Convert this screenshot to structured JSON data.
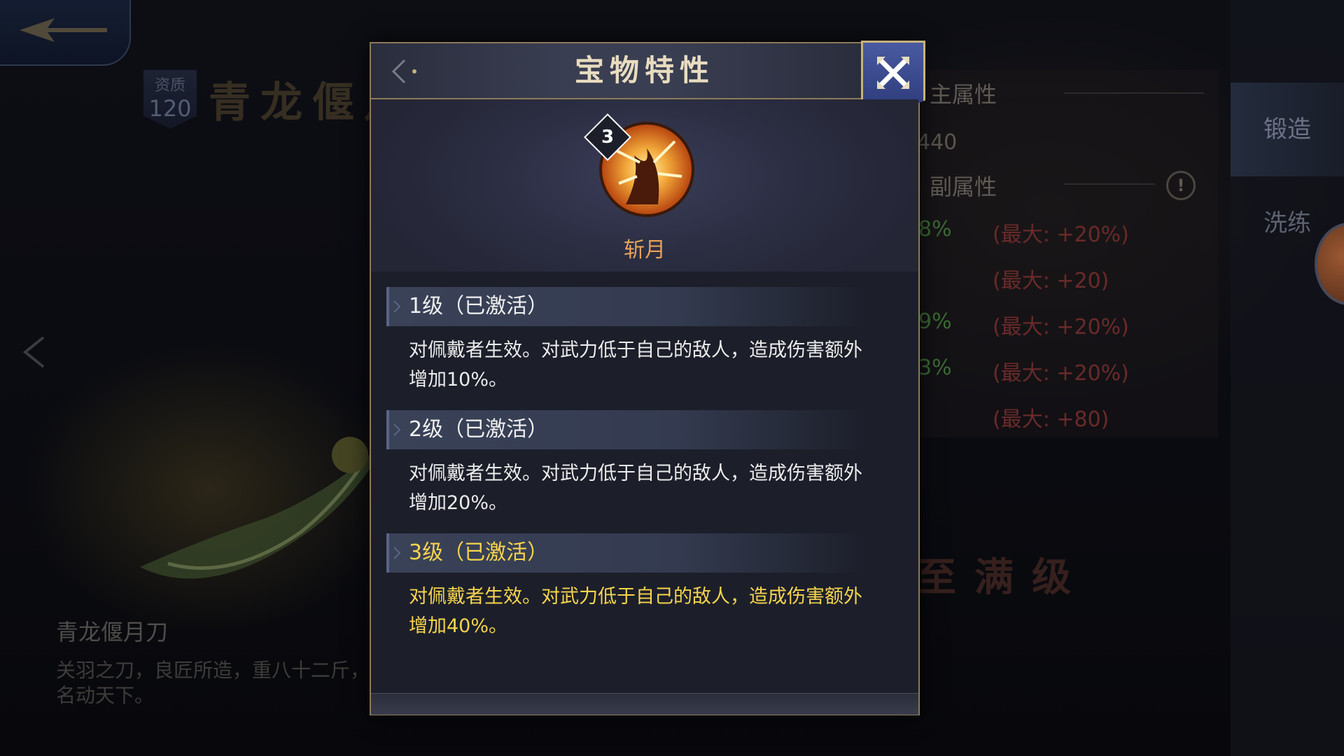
{
  "background": {
    "quality_label": "资质",
    "quality_value": "120",
    "item_title": "青龙偃月",
    "item_name": "青龙偃月刀",
    "item_desc": "关羽之刀，良匠所造，重八十二斤，名动天下。",
    "right_panel": {
      "main_attr_label": "主属性",
      "main_attr_value": "440",
      "sub_attr_label": "副属性",
      "sub_values": [
        "8%",
        "",
        "9%",
        "3%",
        ""
      ],
      "sub_max": [
        "(最大: +20%)",
        "(最大: +20)",
        "(最大: +20%)",
        "(最大: +20%)",
        "(最大: +80)"
      ],
      "upgrade_hint": "至满级"
    },
    "side_tabs": [
      "锻造",
      "洗练"
    ]
  },
  "modal": {
    "title": "宝物特性",
    "skill": {
      "level": "3",
      "name": "斩月",
      "icon": "flame-slash-icon"
    },
    "levels": [
      {
        "title": "1级（已激活）",
        "desc": "对佩戴者生效。对武力低于自己的敌人，造成伤害额外增加10%。",
        "highlight": false
      },
      {
        "title": "2级（已激活）",
        "desc": "对佩戴者生效。对武力低于自己的敌人，造成伤害额外增加20%。",
        "highlight": false
      },
      {
        "title": "3级（已激活）",
        "desc": "对佩戴者生效。对武力低于自己的敌人，造成伤害额外增加40%。",
        "highlight": true
      }
    ]
  },
  "colors": {
    "modal_bg": "#1c1f2a",
    "border_gold": "#8a7a58",
    "highlight_gold": "#f5d44e",
    "skill_name": "#e6a25a",
    "close_button": "#3a4a90"
  }
}
